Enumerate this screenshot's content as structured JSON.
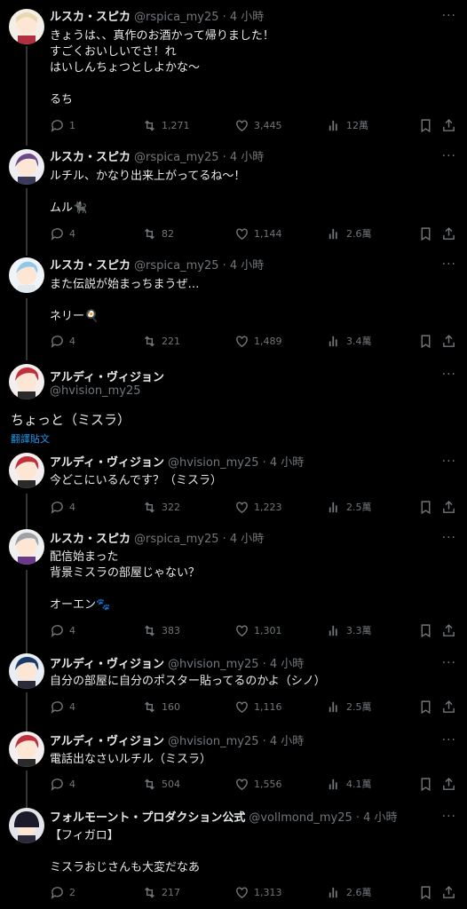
{
  "tweets": [
    {
      "name": "ルスカ・スピカ",
      "handle": "@rspica_my25 · 4 小時",
      "text": "きょうは、、真作のお酒かって帰りました！\nすごくおいしいでさ！れ\nはいしんちょつとしよかな〜\n\nるち",
      "reply": "1",
      "retweet": "1,271",
      "like": "3,445",
      "views": "12萬",
      "avatar_color": "#e8d8b0"
    },
    {
      "name": "ルスカ・スピカ",
      "handle": "@rspica_my25 · 4 小時",
      "text": "ルチル、かなり出来上がってるね〜！\n\nムル🐈‍⬛",
      "reply": "4",
      "retweet": "82",
      "like": "1,144",
      "views": "2.6萬",
      "avatar_color": "#6a4a8a"
    },
    {
      "name": "ルスカ・スピカ",
      "handle": "@rspica_my25 · 4 小時",
      "text": "また伝説が始まっちまうぜ…\n\nネリー🍳",
      "reply": "4",
      "retweet": "221",
      "like": "1,489",
      "views": "3.4萬",
      "avatar_color": "#8fc8e8"
    },
    {
      "name": "アルディ・ヴィジョン",
      "handle": "@hvision_my25 · 4 小時",
      "text": "今どこにいるんです？（ミスラ）",
      "reply": "4",
      "retweet": "322",
      "like": "1,223",
      "views": "2.5萬",
      "avatar_color": "#c0303a"
    },
    {
      "name": "ルスカ・スピカ",
      "handle": "@rspica_my25 · 4 小時",
      "text": "配信始まった\n背景ミスラの部屋じゃない？\n\nオーエン🐾",
      "reply": "4",
      "retweet": "383",
      "like": "1,301",
      "views": "3.3萬",
      "avatar_color": "#a0a0a8"
    },
    {
      "name": "アルディ・ヴィジョン",
      "handle": "@hvision_my25 · 4 小時",
      "text": "自分の部屋に自分のポスター貼ってるのかよ（シノ）",
      "reply": "4",
      "retweet": "160",
      "like": "1,116",
      "views": "2.5萬",
      "avatar_color": "#1a3a6a"
    },
    {
      "name": "アルディ・ヴィジョン",
      "handle": "@hvision_my25 · 4 小時",
      "text": "電話出なさいルチル（ミスラ）",
      "reply": "4",
      "retweet": "504",
      "like": "1,556",
      "views": "4.1萬",
      "avatar_color": "#c0303a"
    },
    {
      "name": "フォルモーント・プロダクション公式",
      "handle": "@vollmond_my25 · 4 小時",
      "text": "【フィガロ】\n\nミスラおじさんも大変だなあ",
      "reply": "2",
      "retweet": "217",
      "like": "1,313",
      "views": "2.6萬",
      "avatar_color": "#1a1a2a"
    }
  ],
  "focus": {
    "name": "アルディ・ヴィジョン",
    "handle": "@hvision_my25",
    "text": "ちょっと（ミスラ）",
    "translate": "翻譯貼文",
    "avatar_color": "#c0303a"
  },
  "more_label": "···"
}
